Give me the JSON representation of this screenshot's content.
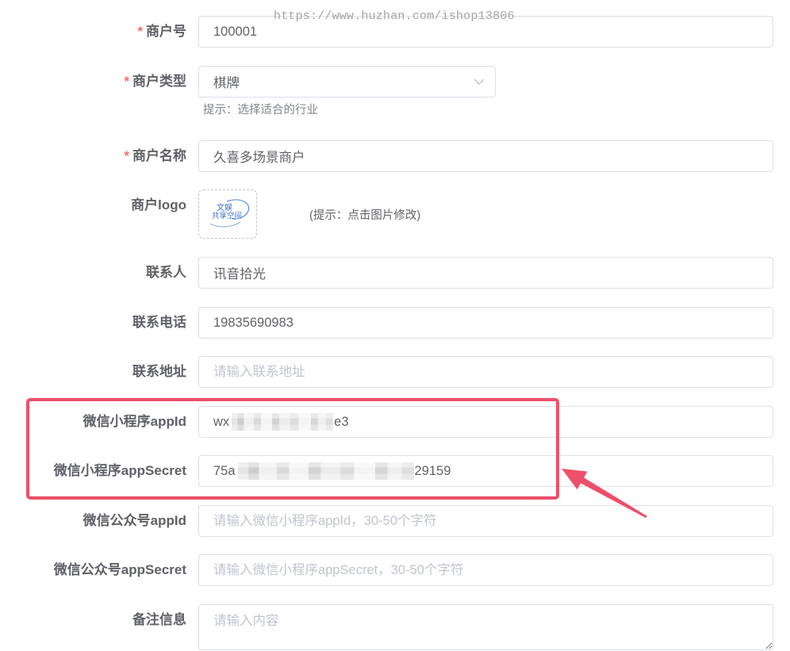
{
  "watermark": "https://www.huzhan.com/ishop13806",
  "colors": {
    "required": "#f56c6c",
    "annotation": "#ee4f6a",
    "label": "#606266",
    "placeholder": "#c0c4cc",
    "border": "#dcdfe6",
    "logo_blue": "#3f6fc2"
  },
  "form": {
    "required_mark": "*",
    "merchant_no": {
      "label": "商户号",
      "value": "100001",
      "required": true
    },
    "merchant_type": {
      "label": "商户类型",
      "value": "棋牌",
      "hint": "提示：选择适合的行业",
      "icon": "chevron-down-icon",
      "required": true
    },
    "merchant_name": {
      "label": "商户名称",
      "value": "久喜多场景商户",
      "required": true
    },
    "merchant_logo": {
      "label": "商户logo",
      "logo_text_top": "文娱",
      "logo_text_bottom": "共享空间",
      "hint": "(提示：点击图片修改)"
    },
    "contact_person": {
      "label": "联系人",
      "value": "讯音拾光"
    },
    "contact_phone": {
      "label": "联系电话",
      "value": "19835690983"
    },
    "contact_address": {
      "label": "联系地址",
      "placeholder": "请输入联系地址"
    },
    "miniprogram_appid": {
      "label": "微信小程序appId",
      "value_visible_start": "wx",
      "value_visible_end": "e3"
    },
    "miniprogram_appsecret": {
      "label": "微信小程序appSecret",
      "value_visible_start": "75a",
      "value_visible_end": "29159"
    },
    "official_appid": {
      "label": "微信公众号appId",
      "placeholder": "请输入微信小程序appId，30-50个字符"
    },
    "official_appsecret": {
      "label": "微信公众号appSecret",
      "placeholder": "请输入微信小程序appSecret，30-50个字符"
    },
    "remark": {
      "label": "备注信息",
      "placeholder": "请输入内容"
    }
  }
}
